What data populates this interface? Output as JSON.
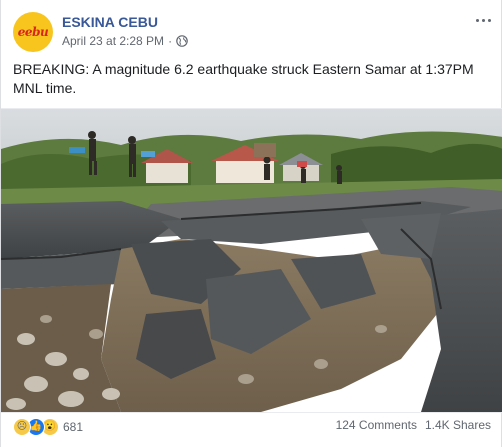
{
  "post": {
    "page_name": "ESKINA CEBU",
    "logo_text": "eebu",
    "timestamp": "April 23 at 2:28 PM",
    "separator": "·",
    "privacy_icon": "globe-icon",
    "more_icon": "ellipsis-icon",
    "text": "BREAKING: A magnitude 6.2 earthquake struck Eastern Samar at 1:37PM MNL time."
  },
  "photo": {
    "subject": "cracked-road-earthquake-photo"
  },
  "footer": {
    "reaction_icons": [
      "sad-icon",
      "like-icon",
      "wow-icon"
    ],
    "reaction_count": "681",
    "comments": "124 Comments",
    "shares": "1.4K Shares"
  },
  "colors": {
    "link_blue": "#385898",
    "meta_gray": "#606770",
    "like_blue": "#1877f2",
    "logo_yellow": "#f7c51e",
    "logo_red": "#d8261c"
  }
}
